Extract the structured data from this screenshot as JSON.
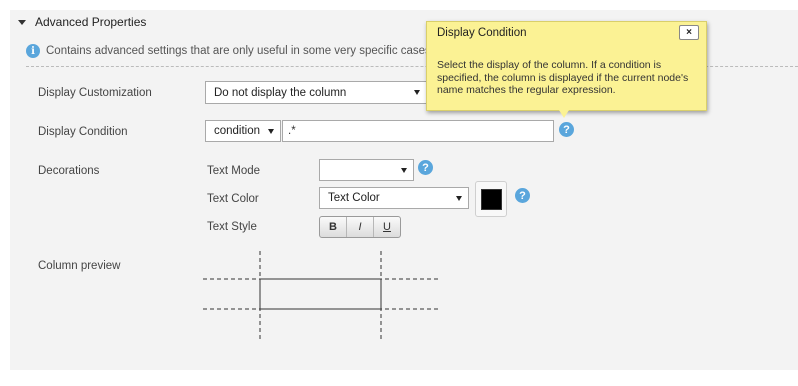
{
  "section": {
    "title": "Advanced Properties",
    "info_text": "Contains advanced settings that are only useful in some very specific cases."
  },
  "fields": {
    "display_customization": {
      "label": "Display Customization",
      "value": "Do not display the column"
    },
    "display_condition": {
      "label": "Display Condition",
      "mode_value": "condition",
      "input_value": ".*"
    },
    "decorations": {
      "label": "Decorations",
      "text_mode": {
        "label": "Text Mode",
        "value": ""
      },
      "text_color": {
        "label": "Text Color",
        "value": "Text Color",
        "swatch_color": "#000000"
      },
      "text_style": {
        "label": "Text Style",
        "bold": "B",
        "italic": "I",
        "underline": "U"
      }
    },
    "column_preview": {
      "label": "Column preview"
    }
  },
  "tooltip": {
    "title": "Display Condition",
    "close_glyph": "×",
    "body": "Select the display of the column. If a condition is specified, the column is displayed if the current node's name matches the regular expression."
  },
  "help_glyph": "?",
  "info_glyph": "i",
  "colors": {
    "help_icon": "#5aa6dc",
    "tooltip_bg": "#fbf294",
    "panel_bg": "#f3f3f3"
  }
}
